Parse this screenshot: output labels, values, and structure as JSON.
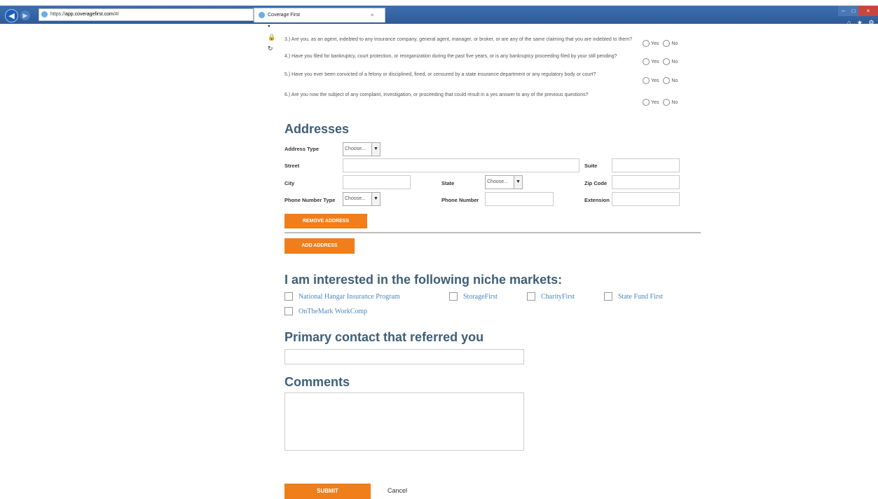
{
  "browser": {
    "url_prefix": "https://",
    "url_host": "app.coveragefirst.com",
    "url_suffix": "/#/",
    "address_tools": "⌕ ▾ 🔒 ↻",
    "tab_title": "Coverage First",
    "tab_close": "×",
    "back_icon": "back-arrow-icon",
    "forward_icon": "forward-arrow-icon",
    "window_controls": {
      "min": "–",
      "max": "□",
      "close": "×"
    },
    "right_icons": "⌂ ★ ⚙"
  },
  "questions": [
    {
      "text": "3.) Are you, as an agent, indebted to any insurance company, general agent, manager, or broker, or are any of the same claiming that you are indebted to them?",
      "yes": "Yes",
      "no": "No"
    },
    {
      "text": "4.) Have you filed for bankruptcy, court protection, or reorganization during the past five years, or is any bankruptcy proceeding filed by your still pending?",
      "yes": "Yes",
      "no": "No"
    },
    {
      "text": "5.) Have you ever been convicted of a felony or disciplined, fined, or censured by a state insurance department or any regulatory body or court?",
      "yes": "Yes",
      "no": "No"
    },
    {
      "text": "6.) Are you now the subject of any complaint, investigation, or proceeding that could result in a yes answer to any of the previous questions?",
      "yes": "Yes",
      "no": "No"
    }
  ],
  "addresses": {
    "heading": "Addresses",
    "address_type_label": "Address Type",
    "address_type_value": "Choose...",
    "street_label": "Street",
    "suite_label": "Suite",
    "city_label": "City",
    "state_label": "State",
    "state_value": "Choose...",
    "zip_label": "Zip Code",
    "phone_type_label": "Phone Number Type",
    "phone_type_value": "Choose...",
    "phone_label": "Phone Number",
    "extension_label": "Extension",
    "remove_button": "REMOVE ADDRESS",
    "add_button": "ADD ADDRESS"
  },
  "niche": {
    "heading": "I am interested in the following niche markets:",
    "options": [
      "National Hangar Insurance Program",
      "StorageFirst",
      "CharityFirst",
      "State Fund First",
      "OnTheMark WorkComp"
    ]
  },
  "referral": {
    "heading": "Primary contact that referred you"
  },
  "comments": {
    "heading": "Comments"
  },
  "actions": {
    "submit": "SUBMIT",
    "cancel": "Cancel"
  },
  "colors": {
    "accent": "#f07e1b",
    "heading": "#3e5f78",
    "link": "#4c87c0",
    "chrome": "#2f5b97"
  }
}
